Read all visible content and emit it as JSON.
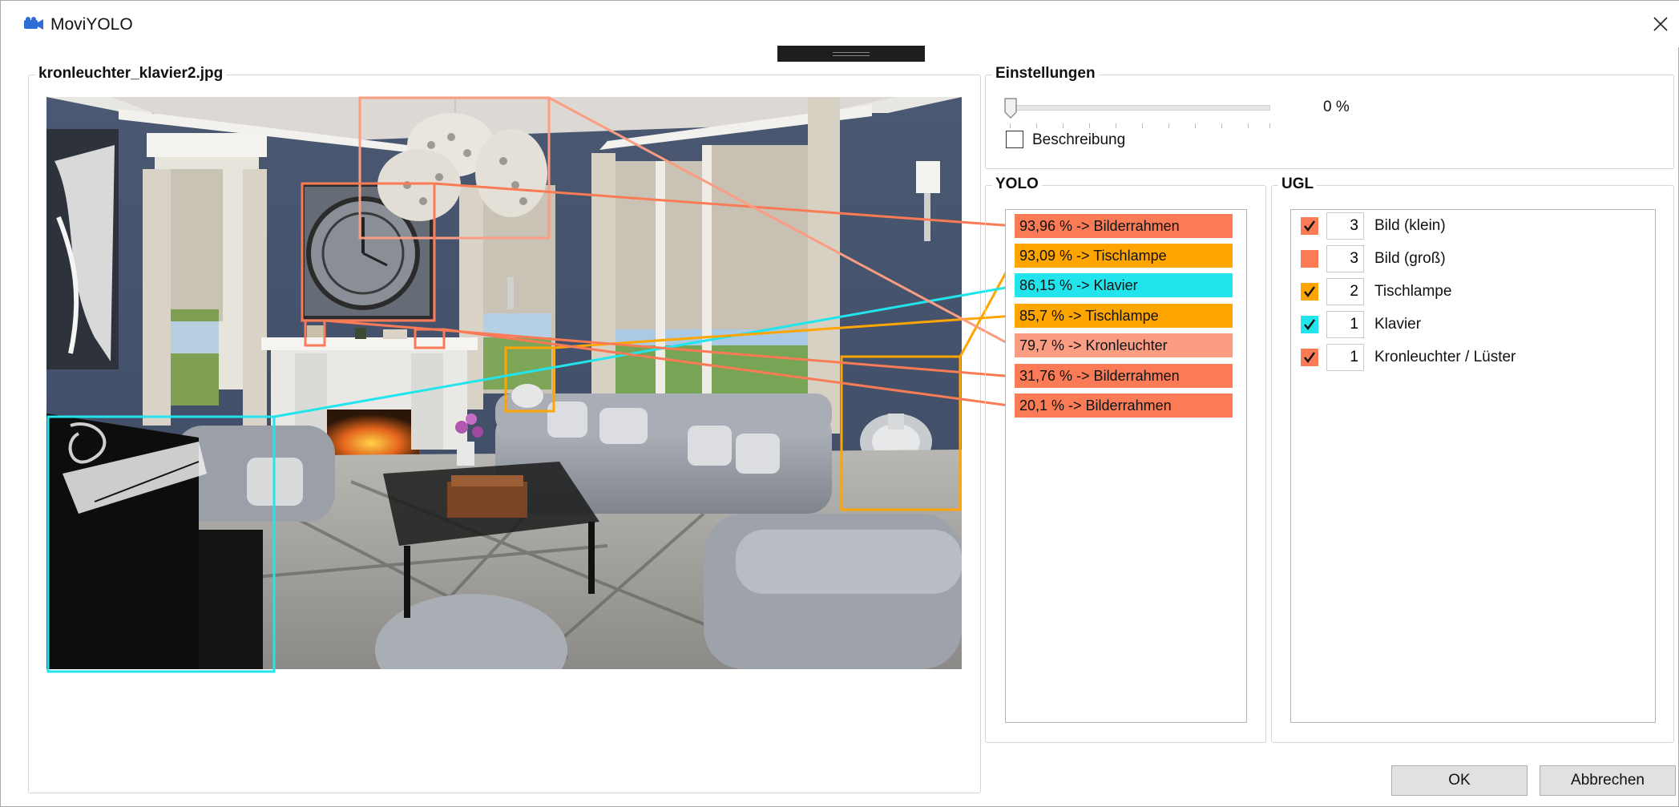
{
  "window": {
    "title": "MoviYOLO",
    "app_icon": "movie-camera-icon",
    "close_icon": "close-icon"
  },
  "image_panel": {
    "title": "kronleuchter_klavier2.jpg"
  },
  "settings": {
    "title": "Einstellungen",
    "slider_value": 0,
    "slider_label": "0 %",
    "description_checkbox_label": "Beschreibung",
    "description_checked": false
  },
  "yolo": {
    "title": "YOLO",
    "items": [
      {
        "label": "93,96 % -> Bilderrahmen",
        "color": "#fa7b55"
      },
      {
        "label": "93,09 % -> Tischlampe",
        "color": "#ffa500"
      },
      {
        "label": "86,15 % -> Klavier",
        "color": "#22e4ec"
      },
      {
        "label": "85,7 % -> Tischlampe",
        "color": "#ffa500"
      },
      {
        "label": "79,7 % -> Kronleuchter",
        "color": "#fb9d82"
      },
      {
        "label": "31,76 % -> Bilderrahmen",
        "color": "#fa7b55"
      },
      {
        "label": "20,1 % -> Bilderrahmen",
        "color": "#fa7b55"
      }
    ]
  },
  "ugl": {
    "title": "UGL",
    "items": [
      {
        "count": "3",
        "label": "Bild (klein)",
        "checked": true,
        "color": "#fa7b55"
      },
      {
        "count": "3",
        "label": "Bild (groß)",
        "checked": false,
        "color": "#fa7b55"
      },
      {
        "count": "2",
        "label": "Tischlampe",
        "checked": true,
        "color": "#ffa500"
      },
      {
        "count": "1",
        "label": "Klavier",
        "checked": true,
        "color": "#22e4ec"
      },
      {
        "count": "1",
        "label": "Kronleuchter / Lüster",
        "checked": true,
        "color": "#fa7b55"
      }
    ]
  },
  "buttons": {
    "ok": "OK",
    "cancel": "Abbrechen"
  },
  "colors": {
    "frame": "#fa7b55",
    "lamp": "#ffa500",
    "piano": "#22e4ec",
    "chandelier": "#fb9d82"
  }
}
